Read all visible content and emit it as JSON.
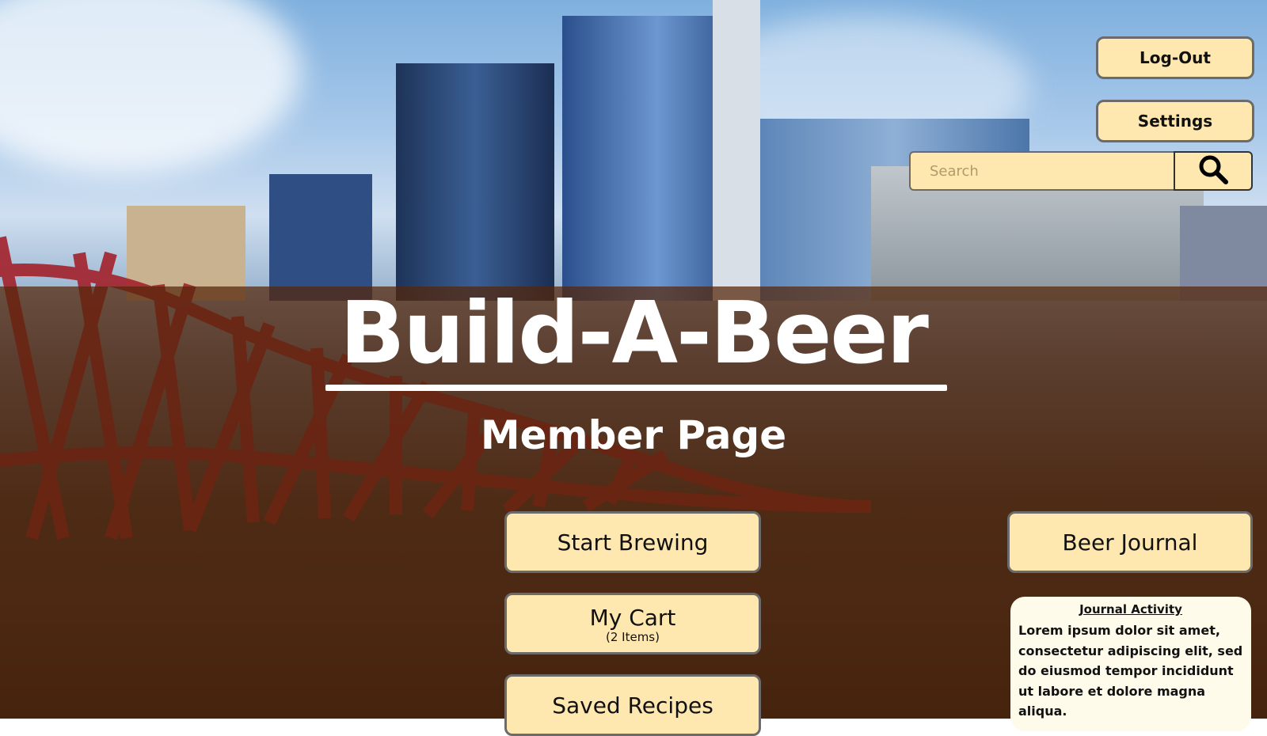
{
  "header": {
    "logout_label": "Log-Out",
    "settings_label": "Settings"
  },
  "search": {
    "placeholder": "Search",
    "value": ""
  },
  "hero": {
    "title": "Build-A-Beer",
    "subtitle": "Member Page"
  },
  "actions": {
    "start_brewing": "Start Brewing",
    "my_cart": "My Cart",
    "my_cart_count": "(2 Items)",
    "saved_recipes": "Saved Recipes",
    "beer_journal": "Beer Journal"
  },
  "journal": {
    "title": "Journal Activity",
    "body": "Lorem ipsum dolor sit amet, consectetur adipiscing elit, sed do eiusmod tempor incididunt ut labore et dolore magna aliqua."
  },
  "icons": {
    "search": "search-icon"
  },
  "colors": {
    "button_fill": "#fee8b0",
    "overlay": "#552608",
    "journal_fill": "#fffbea"
  }
}
